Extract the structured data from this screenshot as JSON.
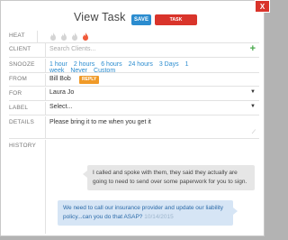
{
  "header": {
    "title": "View Task",
    "save_label": "SAVE",
    "completed_label": "TASK COMPLETED",
    "close_label": "X"
  },
  "fields": {
    "heat": {
      "label": "HEAT",
      "level": 1,
      "max": 4
    },
    "client": {
      "label": "CLIENT",
      "placeholder": "Search Clients..."
    },
    "snooze": {
      "label": "SNOOZE",
      "options": [
        "1 hour",
        "2 hours",
        "6 hours",
        "24 hours",
        "3 Days",
        "1 week",
        "Never",
        "Custom"
      ]
    },
    "from": {
      "label": "FROM",
      "value": "Bill Bob",
      "reply_label": "REPLY"
    },
    "for": {
      "label": "FOR",
      "value": "Laura Jo"
    },
    "task_label": {
      "label": "LABEL",
      "value": "Select..."
    },
    "details": {
      "label": "DETAILS",
      "value": "Please bring it to me when you get it"
    },
    "history": {
      "label": "HISTORY",
      "messages": [
        {
          "text": "I called and spoke with them, they said they actually are going to need to send over some paperwork for you to sign."
        },
        {
          "text": "We need to call our insurance provider and update our liability policy...can you do that ASAP?",
          "date": "10/14/2015"
        }
      ]
    }
  },
  "colors": {
    "accent_blue": "#2b8ccf",
    "danger_red": "#d9342b",
    "reply_orange": "#f09a28",
    "add_green": "#47a84a",
    "flame_active": "#f05a3a",
    "flame_inactive": "#d4d4d4"
  }
}
